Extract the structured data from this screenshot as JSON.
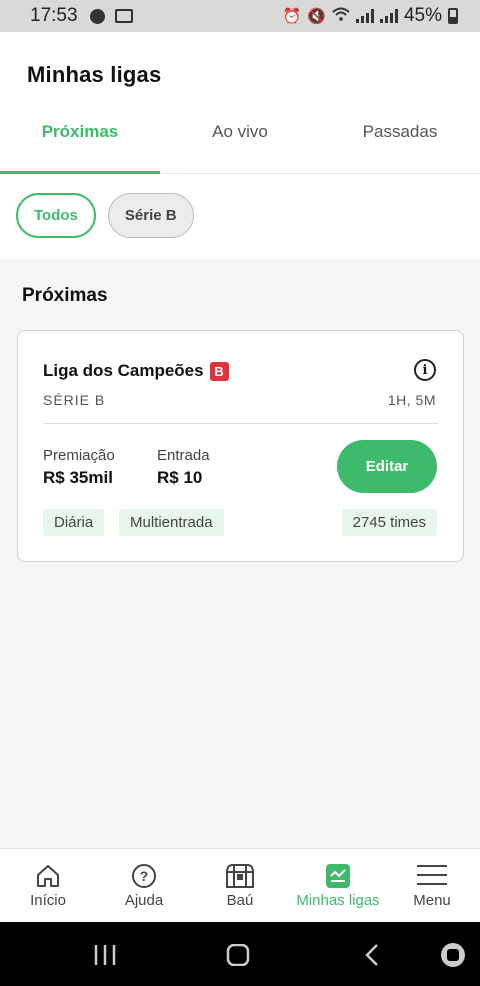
{
  "status_bar": {
    "time": "17:53",
    "battery": "45%"
  },
  "header": {
    "title": "Minhas ligas"
  },
  "tabs": [
    {
      "label": "Próximas",
      "active": true
    },
    {
      "label": "Ao vivo",
      "active": false
    },
    {
      "label": "Passadas",
      "active": false
    }
  ],
  "filters": [
    {
      "label": "Todos",
      "active": true
    },
    {
      "label": "Série B",
      "active": false
    }
  ],
  "section": {
    "title": "Próximas"
  },
  "league_card": {
    "title": "Liga dos Campeões",
    "badge": "B",
    "series": "SÉRIE B",
    "time_left": "1H, 5M",
    "prize_label": "Premiação",
    "prize_value": "R$ 35mil",
    "entry_label": "Entrada",
    "entry_value": "R$ 10",
    "edit_label": "Editar",
    "tags": [
      "Diária",
      "Multientrada"
    ],
    "teams_count": "2745 times"
  },
  "bottom_nav": [
    {
      "label": "Início",
      "icon": "home-icon",
      "active": false
    },
    {
      "label": "Ajuda",
      "icon": "help-icon",
      "active": false
    },
    {
      "label": "Baú",
      "icon": "chest-icon",
      "active": false
    },
    {
      "label": "Minhas ligas",
      "icon": "my-leagues-icon",
      "active": true
    },
    {
      "label": "Menu",
      "icon": "menu-icon",
      "active": false
    }
  ],
  "colors": {
    "accent": "#3dbb6a",
    "badge": "#e0323a"
  }
}
